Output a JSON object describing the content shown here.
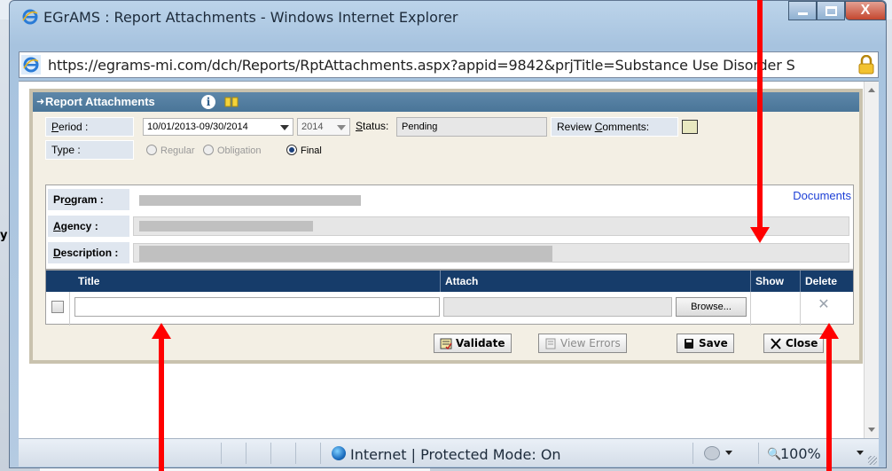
{
  "window": {
    "title": "EGrAMS : Report Attachments - Windows Internet Explorer",
    "close_glyph": "X"
  },
  "address": {
    "url": "https://egrams-mi.com/dch/Reports/RptAttachments.aspx?appid=9842&prjTitle=Substance Use Disorder S"
  },
  "background": {
    "fragment": "y"
  },
  "panel": {
    "title": "Report Attachments",
    "period_label": "Period :",
    "period_value": "10/01/2013-09/30/2014",
    "year_value": "2014",
    "status_label": "Status:",
    "status_value": "Pending",
    "review_label": "Review Comments:",
    "type_label": "Type :",
    "type_options": [
      {
        "label": "Regular",
        "selected": false
      },
      {
        "label": "Obligation",
        "selected": false
      },
      {
        "label": "Final",
        "selected": true
      }
    ],
    "program_label": "Program :",
    "agency_label": "Agency :",
    "description_label": "Description :",
    "documents_link": "Documents"
  },
  "grid": {
    "columns": [
      "Title",
      "Attach",
      "Show",
      "Delete"
    ],
    "browse_label": "Browse...",
    "delete_glyph": "✕"
  },
  "actions": {
    "validate": "Validate",
    "view_errors": "View Errors",
    "save": "Save",
    "close": "Close"
  },
  "statusbar": {
    "zone": "Internet | Protected Mode: On",
    "zoom": "100%"
  },
  "colors": {
    "panel_header": "#4a7598",
    "grid_header": "#163c6a",
    "link": "#1c3fd6",
    "annotation_arrow": "#ff0000"
  }
}
